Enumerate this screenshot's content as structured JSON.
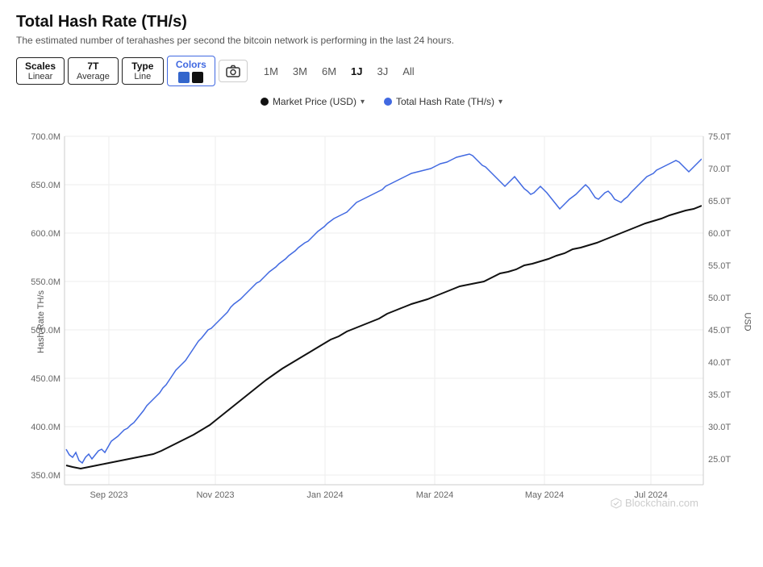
{
  "header": {
    "title": "Total Hash Rate (TH/s)",
    "subtitle": "The estimated number of terahashes per second the bitcoin network is performing in the last 24 hours."
  },
  "toolbar": {
    "scales_label": "Scales",
    "scales_value": "Linear",
    "average_label": "7T",
    "average_value": "Average",
    "type_label": "Type",
    "type_value": "Line",
    "colors_label": "Colors",
    "color1": "#3366cc",
    "color2": "#111111",
    "camera_icon": "📷"
  },
  "time_buttons": [
    "1M",
    "3M",
    "6M",
    "1J",
    "3J",
    "All"
  ],
  "active_time": "1J",
  "legend": {
    "market_price_label": "Market Price (USD)",
    "hash_rate_label": "Total Hash Rate (TH/s)",
    "market_price_color": "#111111",
    "hash_rate_color": "#4169e1"
  },
  "y_axis_left": {
    "label": "Hash Rate TH/s",
    "ticks": [
      "700.0M",
      "650.0M",
      "600.0M",
      "550.0M",
      "500.0M",
      "450.0M",
      "400.0M",
      "350.0M"
    ]
  },
  "y_axis_right": {
    "label": "USD",
    "ticks": [
      "75.0T",
      "70.0T",
      "65.0T",
      "60.0T",
      "55.0T",
      "50.0T",
      "45.0T",
      "40.0T",
      "35.0T",
      "30.0T",
      "25.0T"
    ]
  },
  "x_axis_ticks": [
    "Sep 2023",
    "Nov 2023",
    "Jan 2024",
    "Mar 2024",
    "May 2024",
    "Jul 2024"
  ],
  "watermark": "Blockchain.com"
}
